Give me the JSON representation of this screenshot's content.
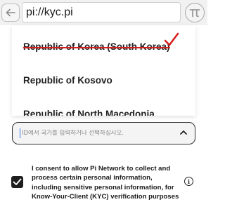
{
  "browser": {
    "url": "pi://kyc.pi",
    "back_icon": "arrow-left-icon",
    "pi_icon": "pi-logo-icon"
  },
  "country_list": {
    "items": [
      {
        "label": "Republic of Korea (South Korea)",
        "selected": true
      },
      {
        "label": "Republic of Kosovo",
        "selected": false
      },
      {
        "label": "Republic of North Macedonia",
        "selected": false
      }
    ],
    "selected_color": "#d62020",
    "check_icon": "checkmark-icon"
  },
  "country_search": {
    "placeholder": "ID에서 국가를 입력하거나 선택하십시오.",
    "value": "",
    "chevron_icon": "chevron-up-icon"
  },
  "consent": {
    "checked": true,
    "text": "I consent to allow Pi Network to collect and process certain personal information, including sensitive personal information, for Know-Your-Client (KYC) verification purposes",
    "info_icon": "info-icon",
    "info_glyph": "i"
  }
}
